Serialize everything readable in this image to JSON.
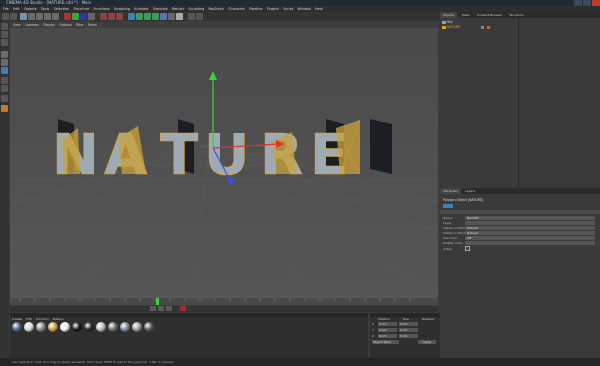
{
  "window": {
    "title": "CINEMA 4D Studio - [NATURE.c4d *] - Main"
  },
  "menu": [
    "File",
    "Edit",
    "Objects",
    "Tools",
    "Selection",
    "Structure",
    "Functions",
    "Snapping",
    "Animate",
    "Simulate",
    "Render",
    "Sculpting",
    "MoGraph",
    "Character",
    "Pipeline",
    "Plugins",
    "Script",
    "Window",
    "Help"
  ],
  "viewport": {
    "menu": [
      "View",
      "Cameras",
      "Display",
      "Options",
      "Filter",
      "Panel"
    ],
    "title": "Perspective",
    "text3d": "NATURE"
  },
  "object_manager": {
    "tabs": [
      "Objects",
      "Takes",
      "Content Browser",
      "Structure"
    ],
    "items": [
      "Sky",
      "NATURE"
    ]
  },
  "attributes": {
    "tabs": [
      "Attributes",
      "Layers"
    ],
    "header": "Polygon Object [NATURE]",
    "rows": [
      {
        "label": "Name",
        "value": "NATURE"
      },
      {
        "label": "Layer",
        "value": ""
      },
      {
        "label": "Visible in Editor",
        "value": "Default"
      },
      {
        "label": "Visible in Renderer",
        "value": "Default"
      },
      {
        "label": "Use Color",
        "value": "Off"
      },
      {
        "label": "Display Color",
        "value": ""
      },
      {
        "label": "X-Ray",
        "value": ""
      }
    ]
  },
  "materials": {
    "menu": [
      "Create",
      "Edit",
      "Function",
      "Texture"
    ],
    "swatches": [
      {
        "name": "blue-mat",
        "color": "#4a6a8a"
      },
      {
        "name": "white-mat",
        "color": "#d8d8d8"
      },
      {
        "name": "grey-mat",
        "color": "#8a8a8a"
      },
      {
        "name": "yellow-mat",
        "color": "#caa34a"
      },
      {
        "name": "white-mat-2",
        "color": "#efefef"
      },
      {
        "name": "dark-mat",
        "color": "#1a1a1a"
      },
      {
        "name": "dark-mat-2",
        "color": "#262626"
      },
      {
        "name": "light-mat",
        "color": "#bdbdbd"
      },
      {
        "name": "grey-mat-2",
        "color": "#6e6e6e"
      },
      {
        "name": "blue-grey-mat",
        "color": "#7c8ea3"
      },
      {
        "name": "silver-mat",
        "color": "#a0a0a0"
      },
      {
        "name": "grey-mat-3",
        "color": "#5d5d5d"
      }
    ]
  },
  "coordinates": {
    "header": [
      "Position",
      "Size",
      "Rotation"
    ],
    "rows": [
      {
        "axis": "X",
        "pos": "0 cm",
        "size": "0 cm",
        "rot": "0 °"
      },
      {
        "axis": "Y",
        "pos": "0 cm",
        "size": "0 cm",
        "rot": "0 °"
      },
      {
        "axis": "Z",
        "pos": "0 cm",
        "size": "0 cm",
        "rot": "0 °"
      }
    ],
    "mode": "Object (Rel)",
    "apply": "Apply"
  },
  "status": {
    "text": "Live Selection: Click and drag to select elements. Hold down SHIFT to add to the selection, CTRL to remove."
  },
  "colors": {
    "accent": "#e7a11c",
    "wire": "#e8a21c",
    "letters": "#9eaab4"
  }
}
